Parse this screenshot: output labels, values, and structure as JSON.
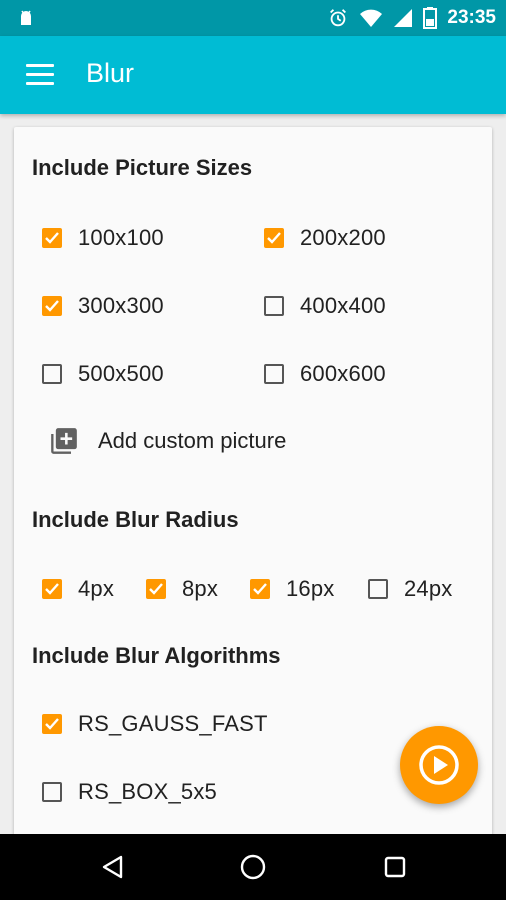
{
  "status_bar": {
    "time": "23:35",
    "icons": [
      "android-icon",
      "alarm-icon",
      "wifi-icon",
      "signal-icon",
      "battery-icon"
    ]
  },
  "app_bar": {
    "title": "Blur",
    "menu_icon": "menu-icon"
  },
  "picture_sizes": {
    "title": "Include Picture Sizes",
    "items": [
      {
        "label": "100x100",
        "checked": true
      },
      {
        "label": "200x200",
        "checked": true
      },
      {
        "label": "300x300",
        "checked": true
      },
      {
        "label": "400x400",
        "checked": false
      },
      {
        "label": "500x500",
        "checked": false
      },
      {
        "label": "600x600",
        "checked": false
      }
    ],
    "add_custom_label": "Add custom picture"
  },
  "blur_radius": {
    "title": "Include Blur Radius",
    "items": [
      {
        "label": "4px",
        "checked": true
      },
      {
        "label": "8px",
        "checked": true
      },
      {
        "label": "16px",
        "checked": true
      },
      {
        "label": "24px",
        "checked": false
      }
    ]
  },
  "blur_algorithms": {
    "title": "Include Blur Algorithms",
    "items": [
      {
        "label": "RS_GAUSS_FAST",
        "checked": true
      },
      {
        "label": "RS_BOX_5x5",
        "checked": false
      }
    ]
  },
  "colors": {
    "primary": "#00bcd4",
    "primary_dark": "#0097a7",
    "accent": "#ff9800"
  },
  "nav_bar": {
    "buttons": [
      "back-icon",
      "home-icon",
      "recents-icon"
    ]
  }
}
